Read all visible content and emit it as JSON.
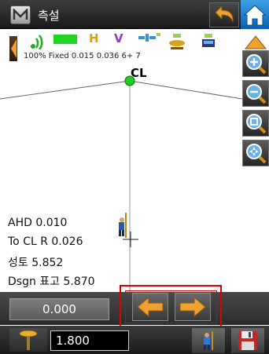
{
  "title_bar": {
    "menu_glyph": "M",
    "title": "측설"
  },
  "status": {
    "battery_percent": "100%",
    "fix_status": "Fixed",
    "h_precision": "0.015",
    "v_precision": "0.036",
    "satellites": "6+ 7",
    "battery_level": 1.0
  },
  "map": {
    "point_label": "CL",
    "point_color": "#22cc22"
  },
  "readout": {
    "ahd": "AHD 0.010",
    "to_cl": "To CL R 0.026",
    "cut_fill": "성토 5.852",
    "design_height": "Dsgn 표고 5.870"
  },
  "offset": {
    "value": "0.000"
  },
  "antenna": {
    "height": "1.800"
  },
  "colors": {
    "accent_orange": "#f0a030",
    "highlight_red": "#e00000",
    "home_blue": "#1a7ad0"
  }
}
